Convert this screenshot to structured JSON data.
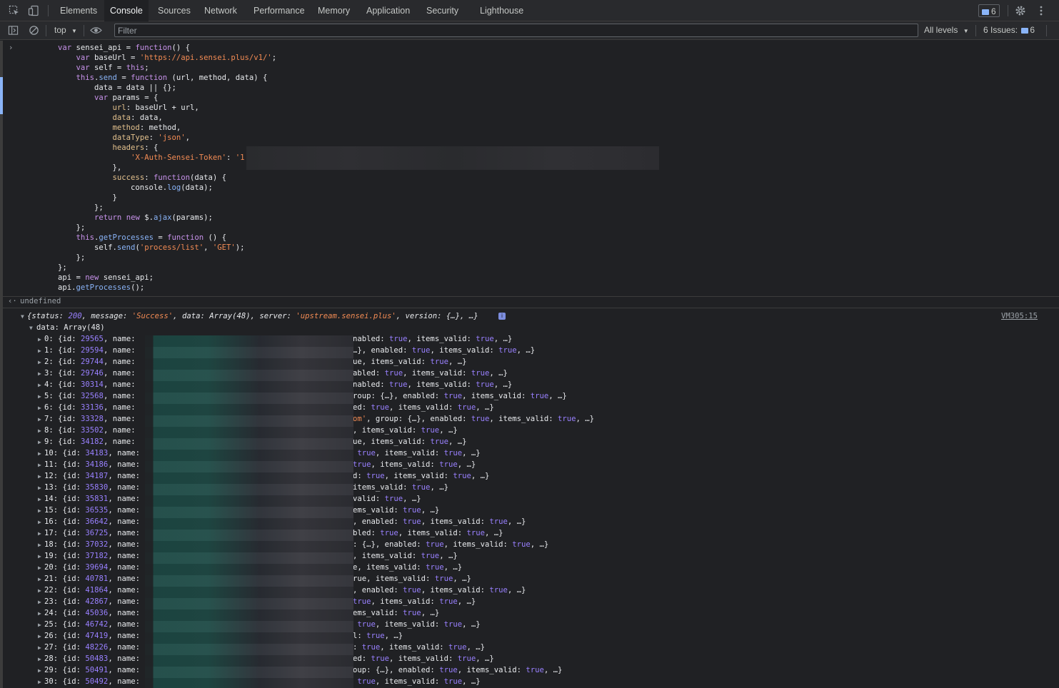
{
  "tabs": [
    "Elements",
    "Console",
    "Sources",
    "Network",
    "Performance",
    "Memory",
    "Application",
    "Security",
    "Lighthouse"
  ],
  "active_tab": "Console",
  "messages_badge": "6",
  "toolbar": {
    "context": "top",
    "filter_placeholder": "Filter",
    "levels": "All levels",
    "issues_label": "6 Issues:",
    "issues_count": "6"
  },
  "code_lines": [
    "var sensei_api = function() {",
    "    var baseUrl = 'https://api.sensei.plus/v1/';",
    "    var self = this;",
    "    this.send = function (url, method, data) {",
    "        data = data || {};",
    "        var params = {",
    "            url: baseUrl + url,",
    "            data: data,",
    "            method: method,",
    "            dataType: 'json',",
    "            headers: {",
    "                'X-Auth-Sensei-Token': '1",
    "            },",
    "            success: function(data) {",
    "                console.log(data);",
    "            }",
    "        };",
    "        return new $.ajax(params);",
    "    };",
    "    this.getProcesses = function () {",
    "        self.send('process/list', 'GET');",
    "    };",
    "};",
    "api = new sensei_api;",
    "api.getProcesses();"
  ],
  "result": "undefined",
  "log": {
    "summary": "{status: 200, message: 'Success', data: Array(48), server: 'upstream.sensei.plus', version: {…}, …}",
    "source": "VM305:15",
    "data_label": "data: Array(48)",
    "rows": [
      {
        "i": "0",
        "id": "29565",
        "tail": "nabled: true, items_valid: true, …}"
      },
      {
        "i": "1",
        "id": "29594",
        "tail": "…}, enabled: true, items_valid: true, …}"
      },
      {
        "i": "2",
        "id": "29744",
        "tail": "ue, items_valid: true, …}"
      },
      {
        "i": "3",
        "id": "29746",
        "tail": "abled: true, items_valid: true, …}"
      },
      {
        "i": "4",
        "id": "30314",
        "tail": "nabled: true, items_valid: true, …}"
      },
      {
        "i": "5",
        "id": "32568",
        "tail": "roup: {…}, enabled: true, items_valid: true, …}"
      },
      {
        "i": "6",
        "id": "33136",
        "tail": "ed: true, items_valid: true, …}"
      },
      {
        "i": "7",
        "id": "33328",
        "tail": "om', group: {…}, enabled: true, items_valid: true, …}"
      },
      {
        "i": "8",
        "id": "33502",
        "tail": ", items_valid: true, …}"
      },
      {
        "i": "9",
        "id": "34182",
        "tail": "ue, items_valid: true, …}"
      },
      {
        "i": "10",
        "id": "34183",
        "tail": " true, items_valid: true, …}"
      },
      {
        "i": "11",
        "id": "34186",
        "tail": "true, items_valid: true, …}"
      },
      {
        "i": "12",
        "id": "34187",
        "tail": "d: true, items_valid: true, …}"
      },
      {
        "i": "13",
        "id": "35830",
        "tail": "items_valid: true, …}"
      },
      {
        "i": "14",
        "id": "35831",
        "tail": "valid: true, …}"
      },
      {
        "i": "15",
        "id": "36535",
        "tail": "ems_valid: true, …}"
      },
      {
        "i": "16",
        "id": "36642",
        "tail": ", enabled: true, items_valid: true, …}"
      },
      {
        "i": "17",
        "id": "36725",
        "tail": "bled: true, items_valid: true, …}"
      },
      {
        "i": "18",
        "id": "37032",
        "tail": ": {…}, enabled: true, items_valid: true, …}"
      },
      {
        "i": "19",
        "id": "37182",
        "tail": ", items_valid: true, …}"
      },
      {
        "i": "20",
        "id": "39694",
        "tail": "e, items_valid: true, …}"
      },
      {
        "i": "21",
        "id": "40781",
        "tail": "rue, items_valid: true, …}"
      },
      {
        "i": "22",
        "id": "41864",
        "tail": ", enabled: true, items_valid: true, …}"
      },
      {
        "i": "23",
        "id": "42867",
        "tail": "true, items_valid: true, …}"
      },
      {
        "i": "24",
        "id": "45036",
        "tail": "ems_valid: true, …}"
      },
      {
        "i": "25",
        "id": "46742",
        "tail": " true, items_valid: true, …}"
      },
      {
        "i": "26",
        "id": "47419",
        "tail": "l: true, …}"
      },
      {
        "i": "27",
        "id": "48226",
        "tail": ": true, items_valid: true, …}"
      },
      {
        "i": "28",
        "id": "50483",
        "tail": "ed: true, items_valid: true, …}"
      },
      {
        "i": "29",
        "id": "50491",
        "tail": "oup: {…}, enabled: true, items_valid: true, …}"
      },
      {
        "i": "30",
        "id": "50492",
        "tail": " true, items_valid: true, …}"
      }
    ]
  }
}
